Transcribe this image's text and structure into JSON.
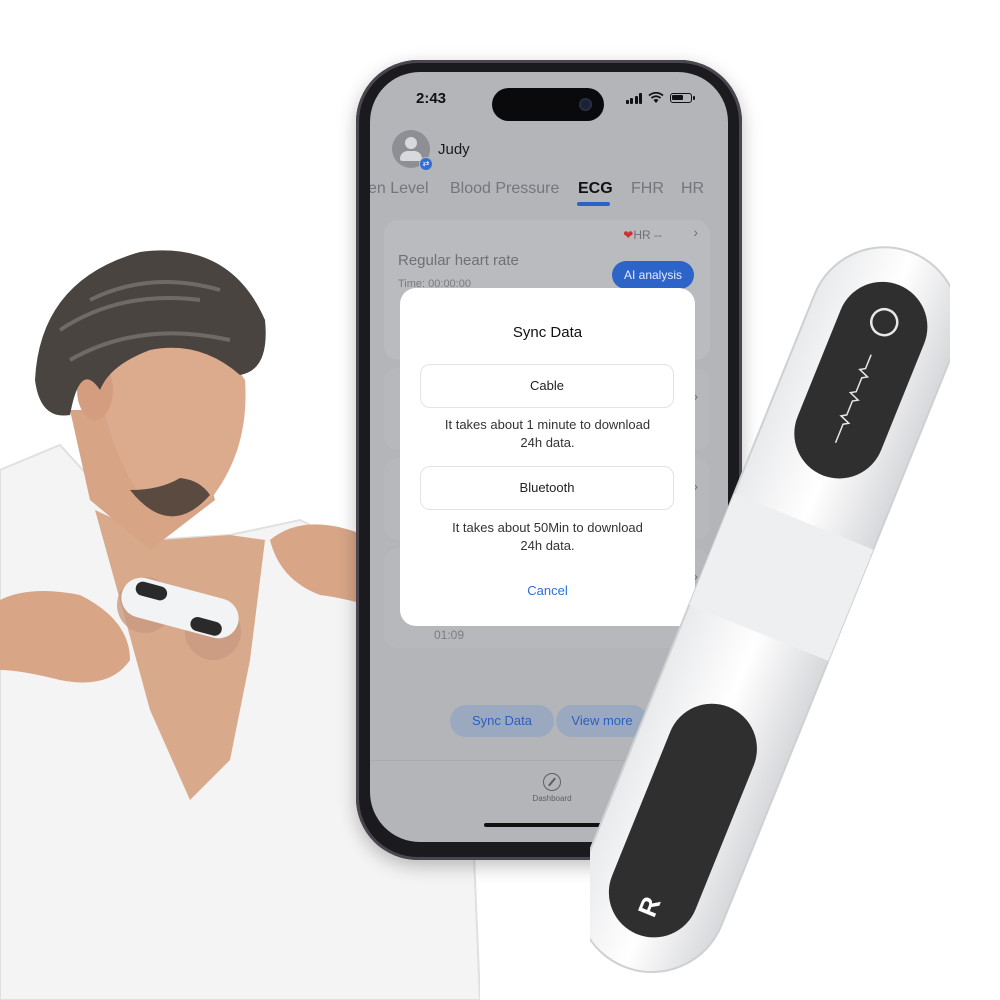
{
  "status_bar": {
    "time": "2:43",
    "icons": [
      "cellular-signal-icon",
      "wifi-icon",
      "battery-icon"
    ]
  },
  "user": {
    "name": "Judy",
    "avatar_icon": "user-avatar-icon",
    "badge_icon": "switch-account-icon"
  },
  "tabs": [
    {
      "label": "en Level",
      "active": false
    },
    {
      "label": "Blood Pressure",
      "active": false
    },
    {
      "label": "ECG",
      "active": true
    },
    {
      "label": "FHR",
      "active": false
    },
    {
      "label": "HR",
      "active": false
    }
  ],
  "record_card": {
    "hr_label": "HR --",
    "heart_icon": "heart-icon",
    "title": "Regular heart rate",
    "time": "Time: 00:00:00",
    "ai_button": "AI analysis"
  },
  "background_record": {
    "time": "01:09"
  },
  "actions": {
    "sync_data": "Sync Data",
    "view_more": "View more"
  },
  "bottom_nav": {
    "dashboard_label": "Dashboard",
    "dashboard_icon": "compass-icon"
  },
  "sync_dialog": {
    "title": "Sync Data",
    "options": [
      {
        "label": "Cable",
        "line1": "It takes about 1 minute to download",
        "line2": "24h data."
      },
      {
        "label": "Bluetooth",
        "line1": "It takes about 50Min to download",
        "line2": "24h data."
      }
    ],
    "cancel": "Cancel"
  },
  "device": {
    "bottom_letter": "R",
    "top_icon": "power-ring-icon",
    "display_icon": "ecg-waveform-icon"
  },
  "colors": {
    "accent": "#2d64c8",
    "cancel": "#2d6fd9",
    "screen_dim": "#b3b5b9",
    "heart": "#d03030"
  }
}
